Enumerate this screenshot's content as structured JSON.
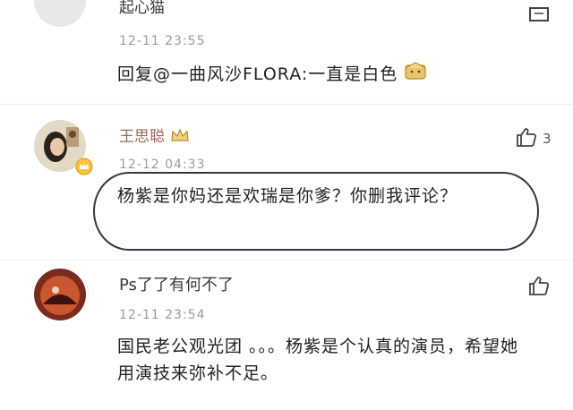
{
  "comments": [
    {
      "username": "起心猫",
      "timestamp": "12-11 23:55",
      "text": "回复@一曲风沙FLORA:一直是白色",
      "like_count": ""
    },
    {
      "username": "王思聪",
      "timestamp": "12-12 04:33",
      "text": "杨紫是你妈还是欢瑞是你爹？你删我评论？",
      "like_count": "3"
    },
    {
      "username": "Ps了了有何不了",
      "timestamp": "12-11 23:54",
      "text": "国民老公观光团 。。。杨紫是个认真的演员，希望她用演技来弥补不足。",
      "like_count": ""
    }
  ],
  "icons": {
    "like": "thumbs-up-icon",
    "reply": "reply-icon",
    "vip": "vip-crown-icon",
    "emoji": "box-emoji-icon"
  },
  "colors": {
    "highlight_oval": "#3b3243",
    "timestamp": "#9a9a9a",
    "text": "#222222"
  }
}
